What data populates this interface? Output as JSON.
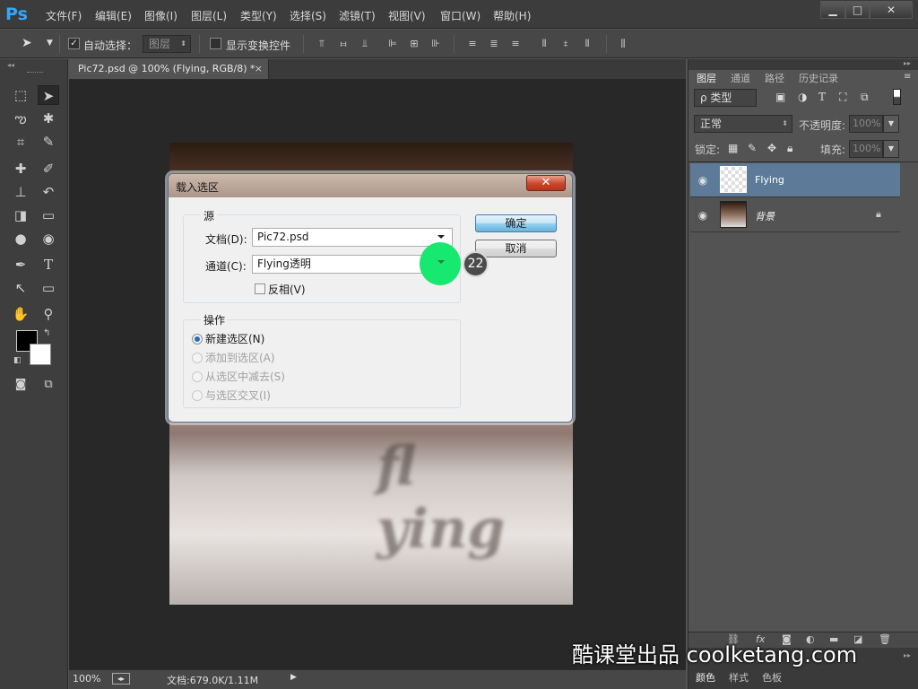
{
  "app": {
    "logo": "Ps",
    "window_buttons": [
      "▁",
      "□",
      "✕"
    ]
  },
  "menu": [
    "文件(F)",
    "编辑(E)",
    "图像(I)",
    "图层(L)",
    "类型(Y)",
    "选择(S)",
    "滤镜(T)",
    "视图(V)",
    "窗口(W)",
    "帮助(H)"
  ],
  "options": {
    "auto_select_label": "自动选择：",
    "auto_select_target": "图层",
    "show_transform_label": "显示变换控件"
  },
  "document": {
    "tab_title": "Pic72.psd @ 100% (Flying, RGB/8) *",
    "tab_close": "×",
    "zoom": "100%",
    "doc_info": "文档:679.0K/1.11M"
  },
  "panel": {
    "tabs": [
      "图层",
      "通道",
      "路径",
      "历史记录"
    ],
    "filter_kind": "ρ 类型",
    "blend_mode": "正常",
    "opacity_label": "不透明度:",
    "opacity_value": "100%",
    "lock_label": "锁定:",
    "fill_label": "填充:",
    "fill_value": "100%",
    "layers": [
      {
        "name": "Flying",
        "selected": true
      },
      {
        "name": "背景",
        "locked": true
      }
    ],
    "bottom_tabs": [
      "颜色",
      "样式",
      "色板"
    ]
  },
  "dialog": {
    "title": "载入选区",
    "close": "✕",
    "source_group": "源",
    "document_label": "文档(D):",
    "document_value": "Pic72.psd",
    "channel_label": "通道(C):",
    "channel_value": "Flying透明",
    "invert_label": "反相(V)",
    "operation_group": "操作",
    "ops": [
      "新建选区(N)",
      "添加到选区(A)",
      "从选区中减去(S)",
      "与选区交叉(I)"
    ],
    "ok": "确定",
    "cancel": "取消"
  },
  "step_badge": "22",
  "watermark": "酷课堂出品 coolketang.com",
  "colors": {
    "highlight": "#17e870",
    "ps_blue": "#31a8ff"
  }
}
